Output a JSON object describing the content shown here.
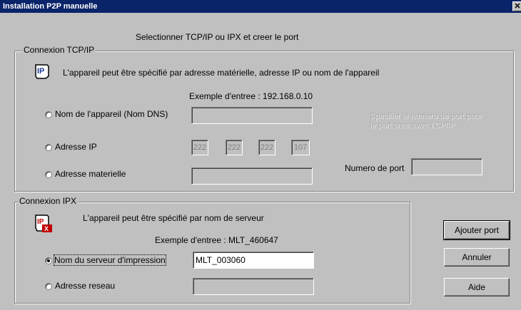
{
  "window": {
    "title": "Installation P2P manuelle"
  },
  "header": {
    "instruction": "Selectionner TCP/IP ou IPX et creer le port"
  },
  "tcpip": {
    "legend": "Connexion TCP/IP",
    "description": "L'appareil peut être spécifié par adresse matérielle, adresse IP ou nom de l'appareil",
    "example": "Exemple d'entree : 192.168.0.10",
    "options": {
      "dns_label": "Nom de l'appareil (Nom DNS)",
      "ip_label": "Adresse IP",
      "mac_label": "Adresse materielle"
    },
    "dns_value": "",
    "ip_octets": [
      "222",
      "222",
      "222",
      "107"
    ],
    "mac_value": "",
    "port_hint": "Specifier le numero de port pour le port cree avec TCP/IP",
    "port_label": "Numero de port",
    "port_value": ""
  },
  "ipx": {
    "legend": "Connexion IPX",
    "description": "L'appareil peut être spécifié par nom de serveur",
    "example": "Exemple d'entree : MLT_460647",
    "options": {
      "server_label": "Nom du serveur d'impression",
      "network_label": "Adresse reseau"
    },
    "server_value": "MLT_003060",
    "network_value": ""
  },
  "buttons": {
    "add_port": "Ajouter port",
    "cancel": "Annuler",
    "help": "Aide"
  },
  "colors": {
    "titlebar": "#0a246a",
    "face": "#c0c0c0",
    "disabled_text": "#a8a8a8"
  }
}
